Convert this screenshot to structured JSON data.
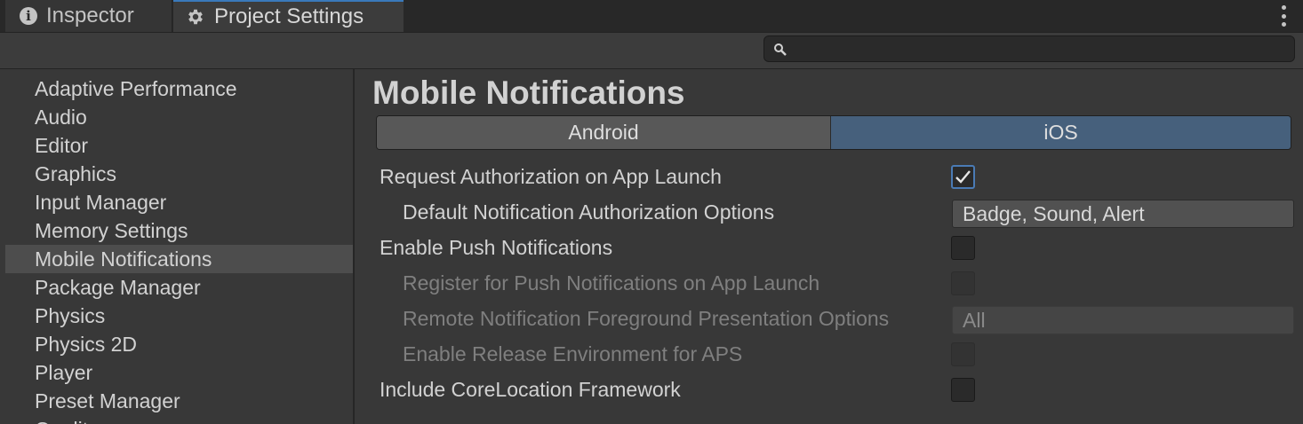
{
  "tabs": {
    "inspector": {
      "label": "Inspector",
      "icon": "info-icon"
    },
    "project_settings": {
      "label": "Project Settings",
      "icon": "gear-icon"
    }
  },
  "search": {
    "placeholder": "",
    "value": ""
  },
  "sidebar": {
    "items": [
      {
        "label": "Adaptive Performance",
        "selected": false
      },
      {
        "label": "Audio",
        "selected": false
      },
      {
        "label": "Editor",
        "selected": false
      },
      {
        "label": "Graphics",
        "selected": false
      },
      {
        "label": "Input Manager",
        "selected": false
      },
      {
        "label": "Memory Settings",
        "selected": false
      },
      {
        "label": "Mobile Notifications",
        "selected": true
      },
      {
        "label": "Package Manager",
        "selected": false
      },
      {
        "label": "Physics",
        "selected": false
      },
      {
        "label": "Physics 2D",
        "selected": false
      },
      {
        "label": "Player",
        "selected": false
      },
      {
        "label": "Preset Manager",
        "selected": false
      },
      {
        "label": "Quality",
        "selected": false
      }
    ]
  },
  "main": {
    "title": "Mobile Notifications",
    "platform_tabs": [
      {
        "label": "Android",
        "active": false
      },
      {
        "label": "iOS",
        "active": true
      }
    ],
    "settings": {
      "request_auth": {
        "label": "Request Authorization on App Launch",
        "checked": true
      },
      "default_auth_options": {
        "label": "Default Notification Authorization Options",
        "value": "Badge, Sound, Alert"
      },
      "enable_push": {
        "label": "Enable Push Notifications",
        "checked": false
      },
      "register_push": {
        "label": "Register for Push Notifications on App Launch",
        "checked": false,
        "disabled": true
      },
      "remote_foreground": {
        "label": "Remote Notification Foreground Presentation Options",
        "value": "All",
        "disabled": true
      },
      "release_env": {
        "label": "Enable Release Environment for APS",
        "checked": false,
        "disabled": true
      },
      "core_location": {
        "label": "Include CoreLocation Framework",
        "checked": false
      }
    }
  },
  "colors": {
    "accent": "#3a79bb",
    "ios_tab_active": "#46607c",
    "selected_row": "#4d4d4d",
    "panel": "#383838"
  }
}
